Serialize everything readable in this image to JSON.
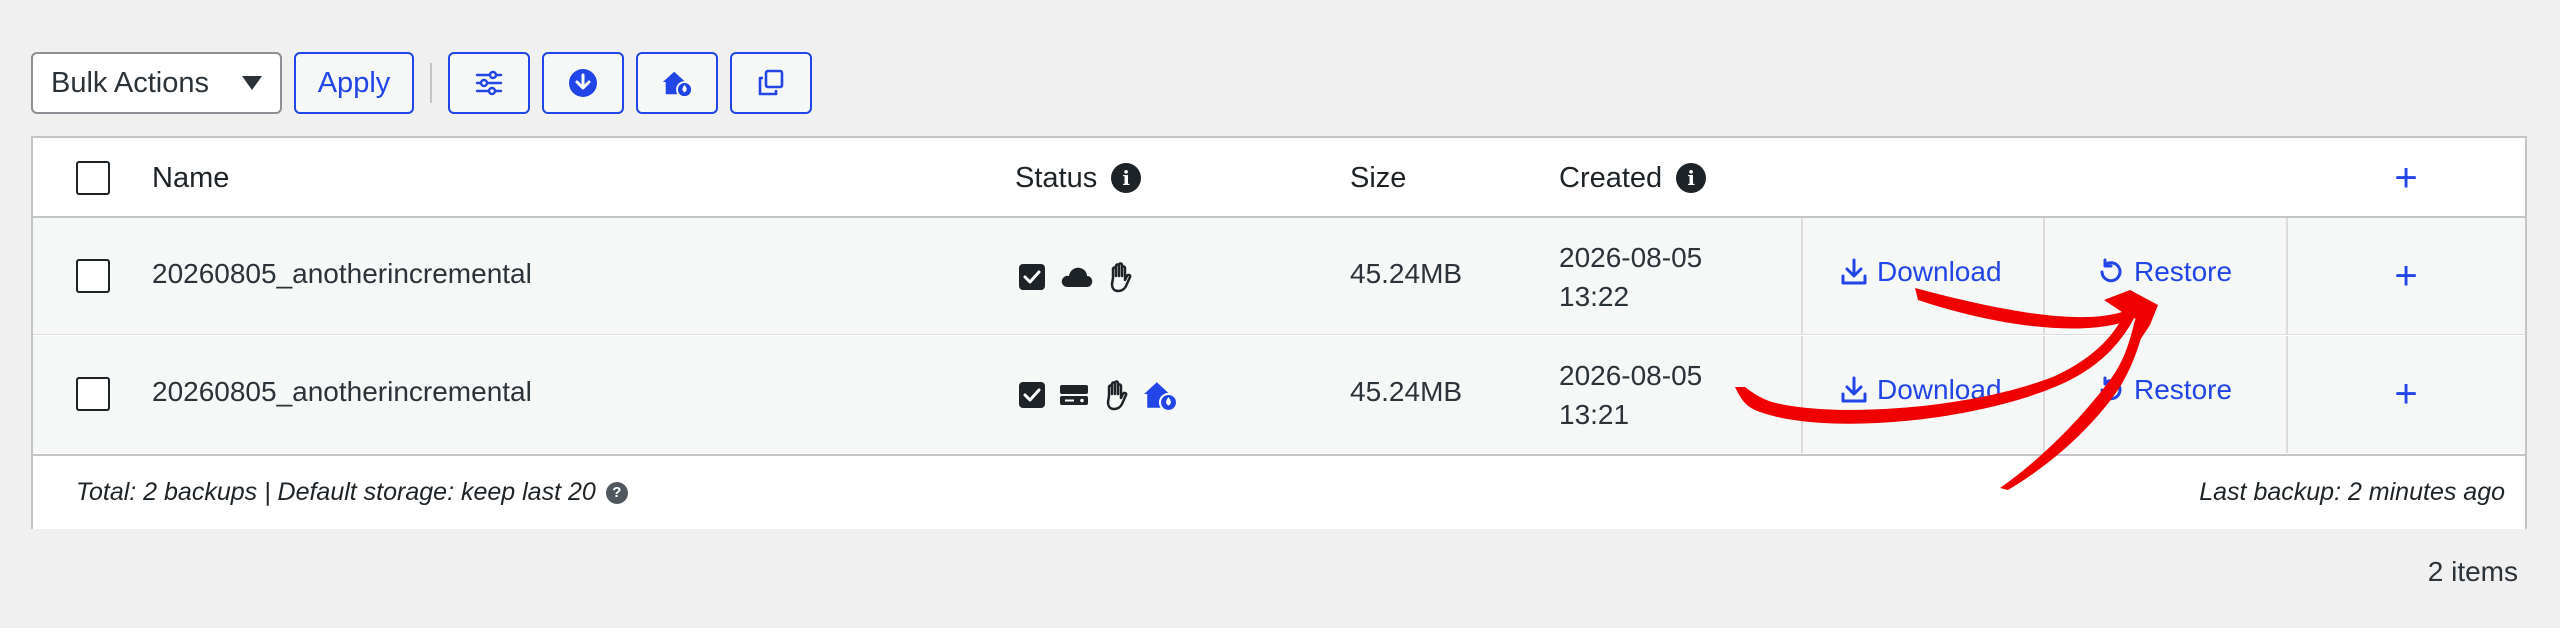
{
  "toolbar": {
    "bulk_actions": "Bulk Actions",
    "apply": "Apply",
    "icons": [
      "sliders-icon",
      "download-circle-icon",
      "house-cloud-icon",
      "copy-icon"
    ]
  },
  "table": {
    "headers": {
      "name": "Name",
      "status": "Status",
      "size": "Size",
      "created": "Created"
    },
    "rows": [
      {
        "name": "20260805_anotherincremental",
        "status_icons": [
          "checkbox-checked-icon",
          "cloud-icon",
          "hand-icon"
        ],
        "size": "45.24MB",
        "created_date": "2026-08-05",
        "created_time": "13:22",
        "download": "Download",
        "restore": "Restore"
      },
      {
        "name": "20260805_anotherincremental",
        "status_icons": [
          "checkbox-checked-icon",
          "server-icon",
          "hand-icon",
          "house-cloud-icon"
        ],
        "size": "45.24MB",
        "created_date": "2026-08-05",
        "created_time": "13:21",
        "download": "Download",
        "restore": "Restore"
      }
    ],
    "footer": {
      "summary": "Total: 2 backups | Default storage: keep last 20",
      "last_backup": "Last backup: 2 minutes ago"
    }
  },
  "items_count": "2 items",
  "colors": {
    "accent": "#2145e6",
    "annotation_arrow": "#f00000",
    "background": "#f0f0f1"
  }
}
